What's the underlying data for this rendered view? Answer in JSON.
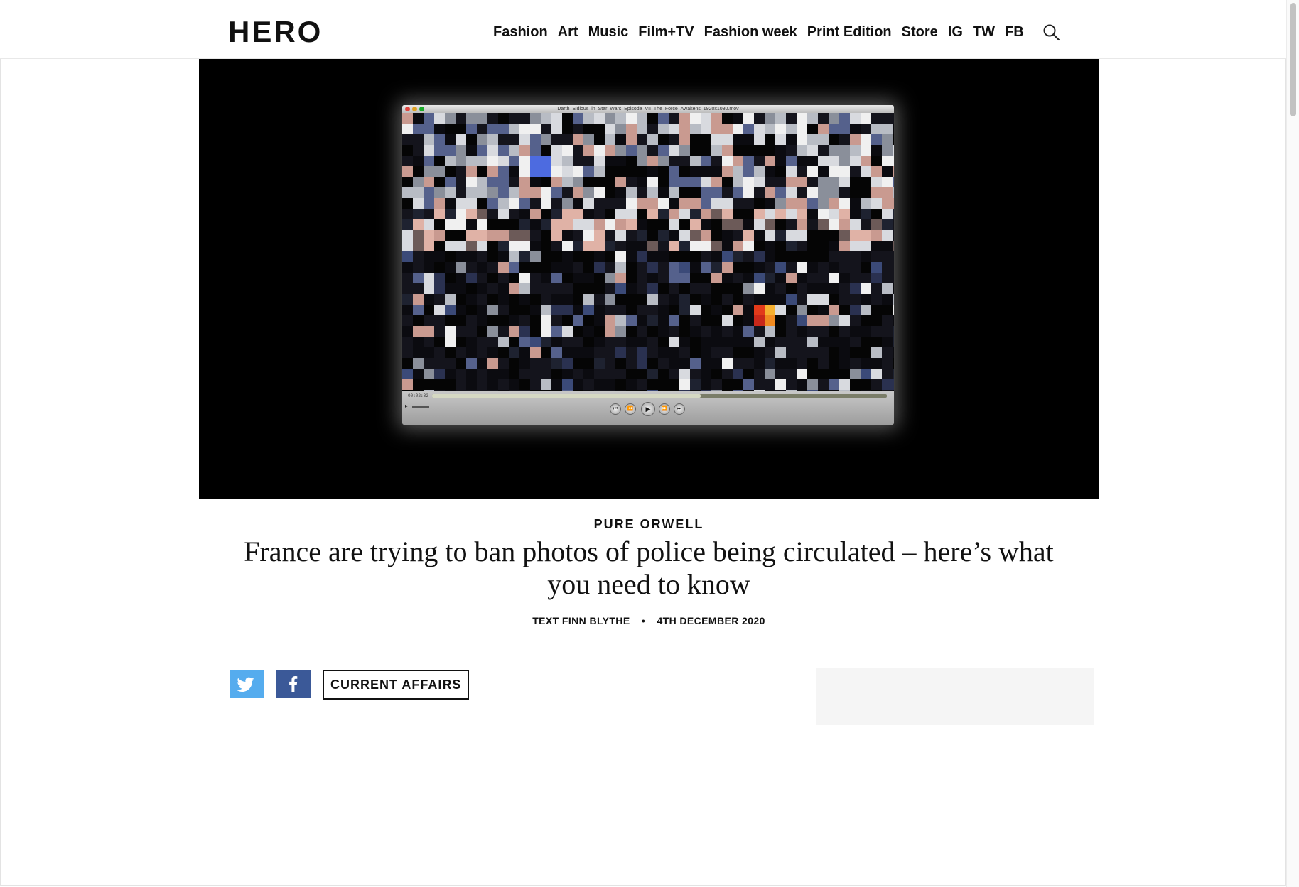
{
  "header": {
    "logo": "HERO",
    "nav": [
      "Fashion",
      "Art",
      "Music",
      "Film+TV",
      "Fashion week",
      "Print Edition",
      "Store",
      "IG",
      "TW",
      "FB"
    ],
    "search_icon": "search-icon"
  },
  "hero": {
    "player": {
      "filename": "Darth_Sidious_in_Star_Wars_Episode_VII_The_Force_Awakens_1920x1080.mov",
      "timecode": "00:02:32",
      "progress": 0.59,
      "controls": [
        "skip-back-icon",
        "rewind-icon",
        "play-icon",
        "fast-forward-icon",
        "skip-forward-icon"
      ]
    }
  },
  "article": {
    "kicker": "PURE ORWELL",
    "headline": "France are trying to ban photos of police being circulated – here’s what you need to know",
    "byline_author": "TEXT FINN BLYTHE",
    "byline_date": "4TH DECEMBER 2020"
  },
  "share": {
    "twitter_icon": "twitter-icon",
    "facebook_icon": "facebook-icon",
    "tag": "CURRENT AFFAIRS",
    "twitter_color": "#55acee",
    "facebook_color": "#3b5998"
  }
}
